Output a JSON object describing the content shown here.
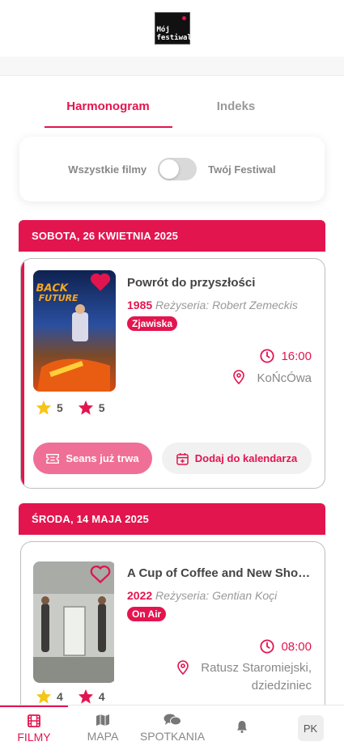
{
  "header": {
    "logo_line1": "Mój",
    "logo_line2": "festiwal"
  },
  "tabs": [
    {
      "label": "Harmonogram",
      "active": true
    },
    {
      "label": "Indeks",
      "active": false
    }
  ],
  "toggle": {
    "left_label": "Wszystkie filmy",
    "right_label": "Twój Festiwal",
    "on": false
  },
  "days": [
    {
      "label": "SOBOTA, 26 KWIETNIA 2025",
      "film": {
        "title": "Powrót do przyszłości",
        "year": "1985",
        "director": "Reżyseria: Robert Zemeckis",
        "section": "Zjawiska",
        "time": "16:00",
        "venue": "KoŃcÓwa",
        "rating_public": "5",
        "rating_user": "5",
        "favorited": true,
        "live_label": "Seans już trwa",
        "calendar_label": "Dodaj do kalendarza"
      }
    },
    {
      "label": "ŚRODA, 14 MAJA 2025",
      "film": {
        "title": "A Cup of Coffee and New Shoes On",
        "year": "2022",
        "director": "Reżyseria: Gentian Koçi",
        "section": "On Air",
        "time": "08:00",
        "venue_line1": "Ratusz Staromiejski,",
        "venue_line2": "dziedziniec",
        "rating_public": "4",
        "rating_user": "4",
        "favorited": false
      }
    }
  ],
  "nav": {
    "items": [
      {
        "label": "FILMY",
        "icon": "film-icon",
        "active": true
      },
      {
        "label": "MAPA",
        "icon": "map-icon",
        "active": false
      },
      {
        "label": "SPOTKANIA",
        "icon": "chat-icon",
        "active": false
      },
      {
        "label": "",
        "icon": "bell-icon",
        "active": false
      }
    ],
    "profile_initials": "PK"
  },
  "colors": {
    "accent": "#e3154f",
    "accent_light": "#ef6f96",
    "star_yellow": "#f5c518"
  }
}
